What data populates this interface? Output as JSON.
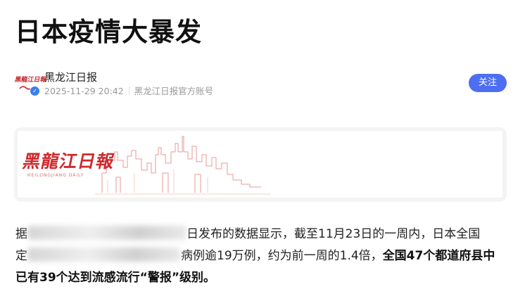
{
  "article": {
    "title": "日本疫情大暴发",
    "author": {
      "name": "黑龙江日报",
      "datetime": "2025-11-29 20:42",
      "account_type": "黑龙江日报官方账号",
      "avatar_text": "黑龍江日報",
      "follow_label": "关注"
    },
    "banner": {
      "logo_text": "黑龍江日報",
      "subtitle": "HEILONGJIANG DAILY"
    },
    "body": {
      "line1_start": "据",
      "line1_end": "日发布的数据显示，截至11月23日的一周内，日本全国",
      "line2_start": "定",
      "line2_end": "病例逾19万例，约为前一周的1.4倍，",
      "line2_bold": "全国47个都道府县中",
      "line3_bold": "已有39个达到流感流行“警报”级别。"
    }
  },
  "colors": {
    "brand_red": "#cf2a2d",
    "follow_blue": "#4e6ef2",
    "verified_blue": "#3a7ff0"
  }
}
